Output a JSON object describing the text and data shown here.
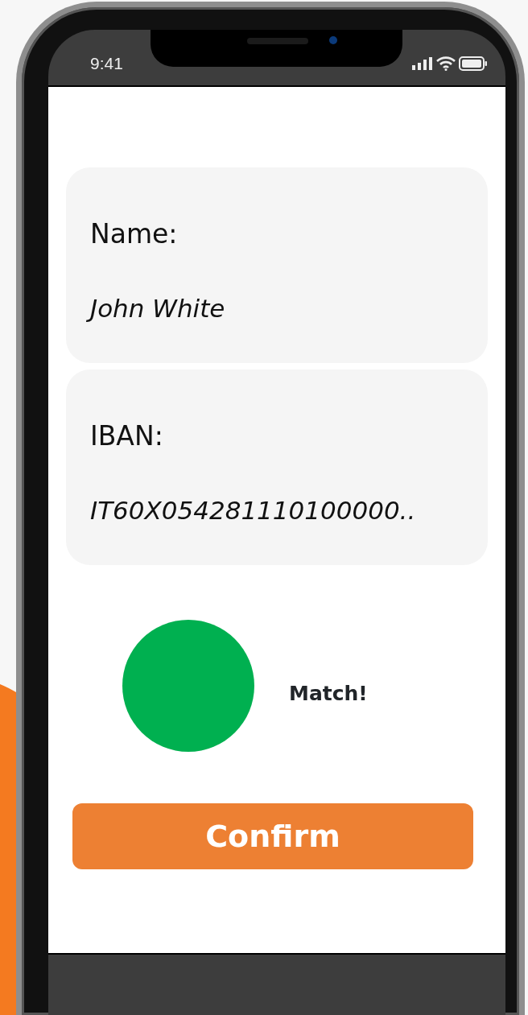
{
  "status_bar": {
    "time": "9:41"
  },
  "fields": [
    {
      "label": "Name:",
      "value": "John White"
    },
    {
      "label": "IBAN:",
      "value": "IT60X054281110100000.."
    }
  ],
  "match": {
    "color": "#00b050",
    "text": "Match!"
  },
  "button": {
    "label": "Confirm"
  }
}
